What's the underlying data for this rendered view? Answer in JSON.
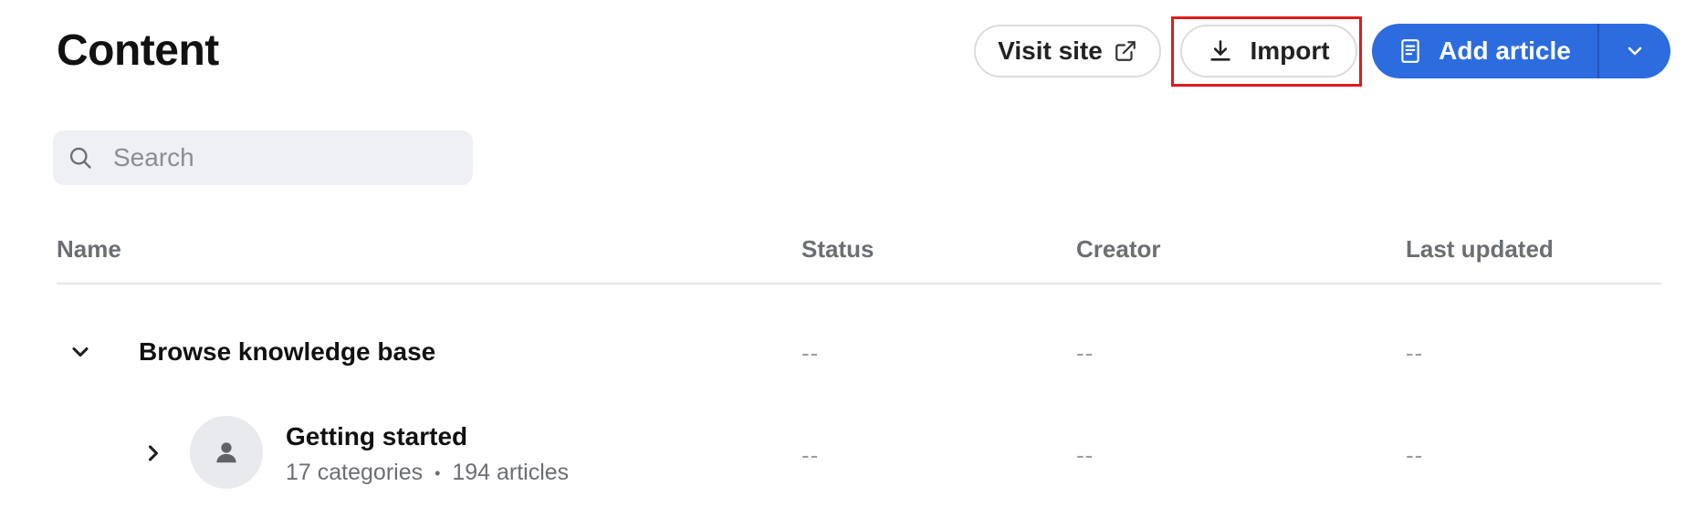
{
  "header": {
    "title": "Content",
    "visit_site_label": "Visit site",
    "import_label": "Import",
    "add_article_label": "Add article"
  },
  "search": {
    "placeholder": "Search",
    "value": ""
  },
  "table": {
    "columns": [
      "Name",
      "Status",
      "Creator",
      "Last updated"
    ],
    "rows": [
      {
        "name": "Browse knowledge base",
        "status": "--",
        "creator": "--",
        "last_updated": "--"
      },
      {
        "name": "Getting started",
        "categories": "17 categories",
        "separator": "•",
        "articles": "194 articles",
        "status": "--",
        "creator": "--",
        "last_updated": "--"
      }
    ]
  },
  "icons": {
    "visit_site": "external-link-icon",
    "import": "download-icon",
    "add_article": "document-icon",
    "dropdown": "chevron-down-icon",
    "search": "search-icon",
    "expand": "chevron-down-icon",
    "collapse": "chevron-right-icon",
    "avatar": "person-icon"
  },
  "colors": {
    "primary": "#2d6cdf",
    "highlight": "#e01b1b"
  }
}
